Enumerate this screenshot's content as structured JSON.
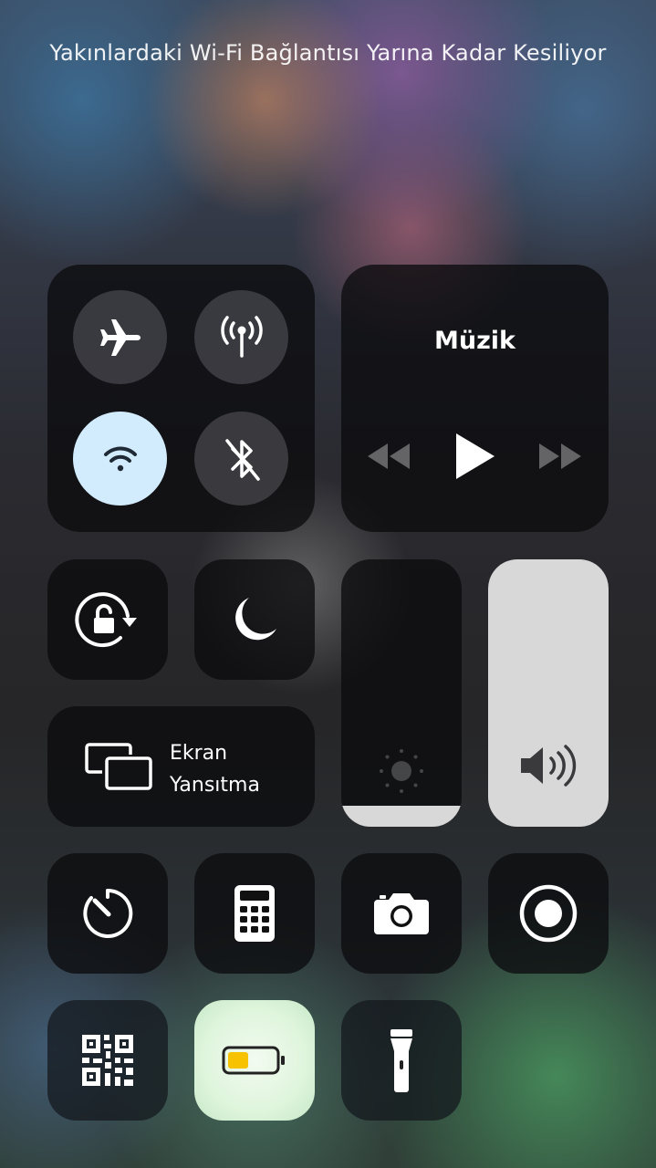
{
  "notification": {
    "text": "Yakınlardaki Wi-Fi Bağlantısı Yarına Kadar Kesiliyor"
  },
  "connectivity": {
    "airplane": {
      "icon": "airplane-icon",
      "on": false
    },
    "cellular": {
      "icon": "cellular-antenna-icon",
      "on": false
    },
    "wifi": {
      "icon": "wifi-icon",
      "on": true
    },
    "bluetooth": {
      "icon": "bluetooth-off-icon",
      "on": false
    }
  },
  "music": {
    "title": "Müzik",
    "controls": [
      "rewind-icon",
      "play-icon",
      "fast-forward-icon"
    ]
  },
  "toggles": {
    "orientation_lock": {
      "icon": "orientation-lock-icon"
    },
    "do_not_disturb": {
      "icon": "moon-icon"
    }
  },
  "screen_mirroring": {
    "line1": "Ekran",
    "line2": "Yansıtma",
    "icon": "screen-mirroring-icon"
  },
  "brightness": {
    "level": 0.08,
    "icon": "sun-icon"
  },
  "volume": {
    "level": 1.0,
    "icon": "speaker-icon"
  },
  "shortcuts": [
    {
      "name": "timer",
      "icon": "timer-icon"
    },
    {
      "name": "calculator",
      "icon": "calculator-icon"
    },
    {
      "name": "camera",
      "icon": "camera-icon"
    },
    {
      "name": "screen-recording",
      "icon": "record-icon"
    },
    {
      "name": "qr-scanner",
      "icon": "qr-code-icon"
    },
    {
      "name": "low-power-mode",
      "icon": "battery-icon",
      "on": true
    },
    {
      "name": "flashlight",
      "icon": "flashlight-icon"
    }
  ],
  "colors": {
    "tile": "#0c0c0e",
    "active_toggle": "#d3ecfd",
    "wifi_icon_active": "#1f2a36",
    "battery_low_power": "#f7c300",
    "slider_fill": "#d8d8d8"
  }
}
